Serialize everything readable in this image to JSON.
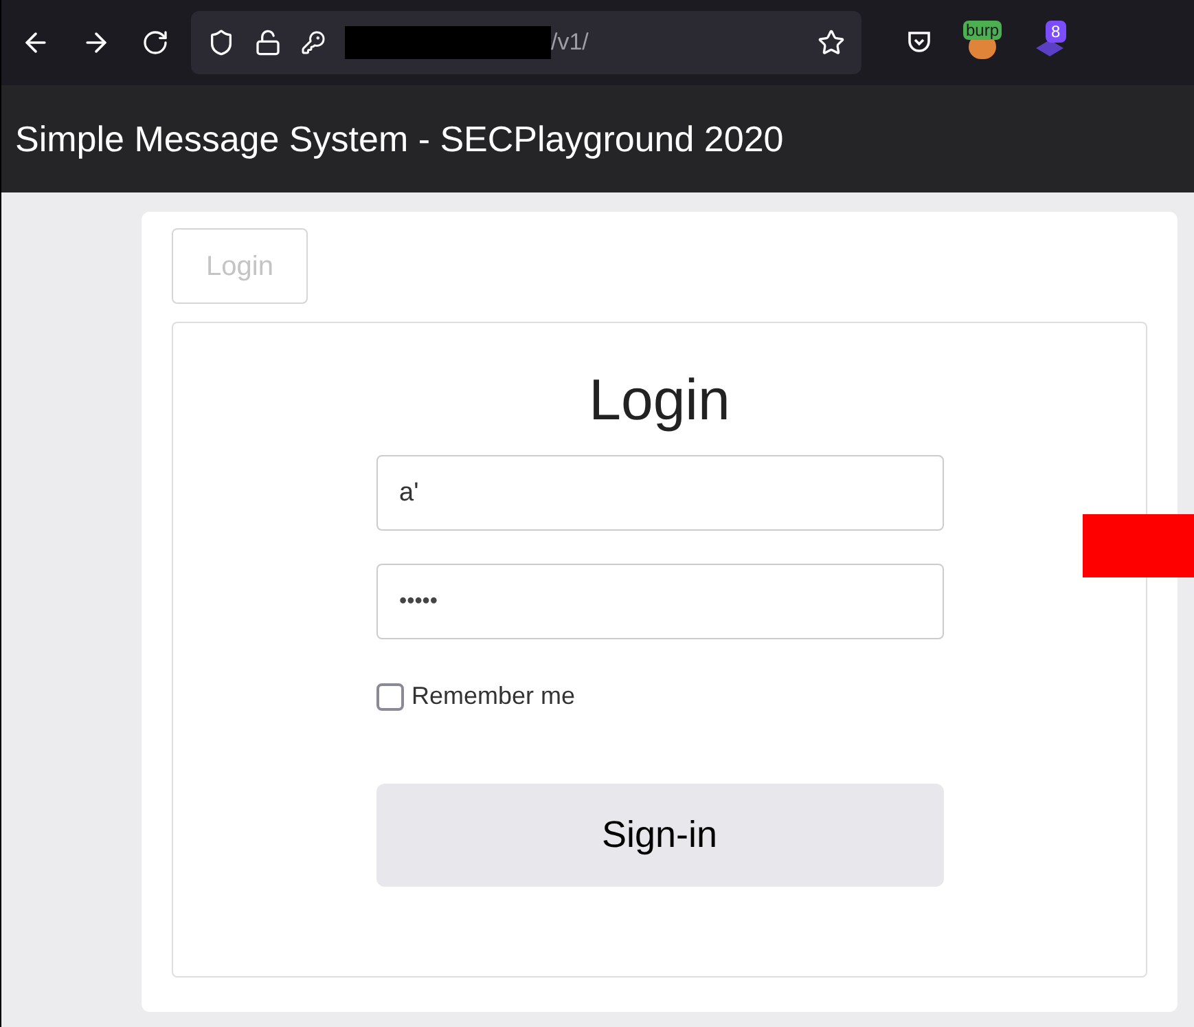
{
  "browser": {
    "url_suffix": "/v1/",
    "extensions": [
      {
        "kind": "burp",
        "badge": "burp"
      },
      {
        "kind": "stack",
        "badge": "8"
      }
    ]
  },
  "header": {
    "title": "Simple Message System - SECPlayground 2020"
  },
  "tab": {
    "label": "Login",
    "disabled": true
  },
  "form": {
    "heading": "Login",
    "username": "a'",
    "password": "•••••",
    "remember": {
      "label": "Remember me",
      "checked": false
    },
    "submit": "Sign-in"
  }
}
